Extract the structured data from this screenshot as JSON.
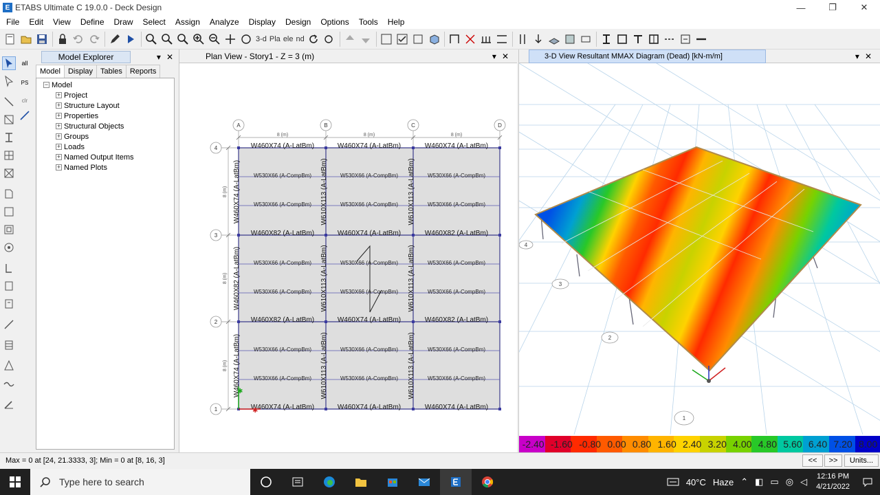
{
  "window": {
    "title": "ETABS Ultimate C 19.0.0 - Deck Design",
    "logo_letter": "E",
    "minimize": "—",
    "restore": "❐",
    "close": "✕"
  },
  "menu": [
    "File",
    "Edit",
    "View",
    "Define",
    "Draw",
    "Select",
    "Assign",
    "Analyze",
    "Display",
    "Design",
    "Options",
    "Tools",
    "Help"
  ],
  "toolbar": {
    "view3d_label": "3-d",
    "pla_label": "Pla",
    "elev_label": "ele",
    "nd_label": "nd"
  },
  "explorer": {
    "title": "Model Explorer",
    "tabs": [
      "Model",
      "Display",
      "Tables",
      "Reports"
    ],
    "root": "Model",
    "items": [
      "Project",
      "Structure Layout",
      "Properties",
      "Structural Objects",
      "Groups",
      "Loads",
      "Named Output Items",
      "Named Plots"
    ]
  },
  "vtoolbar": {
    "all_label": "all",
    "ps_label": "PS",
    "clr_label": "clr"
  },
  "plan_view": {
    "title": "Plan View - Story1 - Z = 3 (m)",
    "grid_x": [
      "A",
      "B",
      "C",
      "D"
    ],
    "grid_y": [
      "4",
      "3",
      "2",
      "1"
    ],
    "span_label": "8 (m)",
    "top_beam": "W460X74 (A-LatBm)",
    "mid_beam_82": "W460X82 (A-LatBm)",
    "bottom_beam": "W460X74 (A-LatBm)",
    "comp_beam": "W530X66 (A-CompBm)",
    "col_left_top": "W460X74 (A-LatBm)",
    "col_left_mid": "W460X82 (A-LatBm)",
    "col_left_bot": "W460X74 (A-LatBm)",
    "col_inner": "W610X113 (A-LatBm)"
  },
  "view3d": {
    "title": "3-D View   Resultant MMAX Diagram   (Dead)  [kN-m/m]",
    "grid_labels": [
      "1",
      "2",
      "3",
      "4"
    ]
  },
  "legend": {
    "values": [
      "-2.40",
      "-1.60",
      "-0.80",
      "0.00",
      "0.80",
      "1.60",
      "2.40",
      "3.20",
      "4.00",
      "4.80",
      "5.60",
      "6.40",
      "7.20",
      "8.00"
    ],
    "colors": [
      "#c800c8",
      "#e0002a",
      "#ff2a00",
      "#ff5a00",
      "#ff8c00",
      "#ffb400",
      "#ffd200",
      "#c8d200",
      "#78d200",
      "#28c828",
      "#00c8a0",
      "#00a0d2",
      "#0050e6",
      "#0000c8"
    ]
  },
  "status": {
    "text": "Max = 0 at [24, 21.3333, 3];  Min = 0 at [8, 16, 3]",
    "prev_btn": "<<",
    "next_btn": ">>",
    "units_btn": "Units..."
  },
  "taskbar": {
    "search_placeholder": "Type here to search",
    "weather_temp": "40°C",
    "weather_desc": "Haze",
    "time": "12:16 PM",
    "date": "4/21/2022"
  }
}
